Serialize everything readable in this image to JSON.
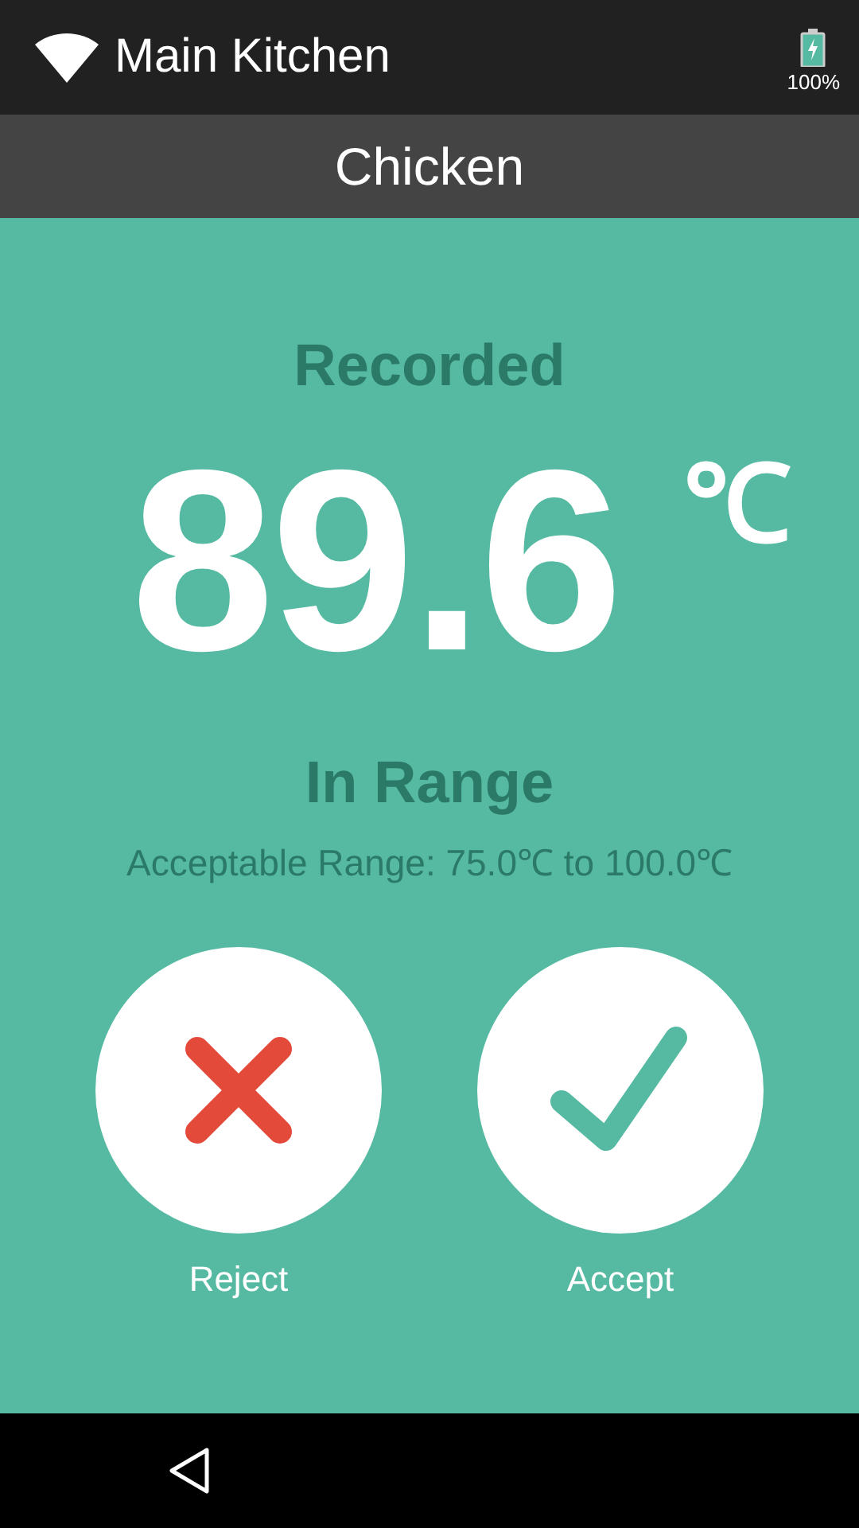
{
  "status_bar": {
    "network": "Main Kitchen",
    "battery": "100%"
  },
  "header": {
    "title": "Chicken"
  },
  "reading": {
    "label": "Recorded",
    "value": "89.6",
    "unit": "℃",
    "status": "In Range",
    "range": "Acceptable Range: 75.0℃ to 100.0℃"
  },
  "actions": [
    {
      "kind": "reject",
      "label": "Reject"
    },
    {
      "kind": "accept",
      "label": "Accept"
    }
  ]
}
